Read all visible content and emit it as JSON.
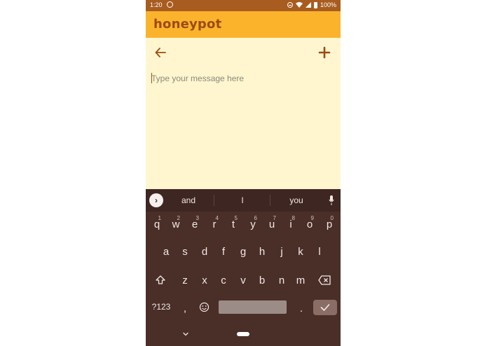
{
  "status_bar": {
    "time": "1:20",
    "battery": "100%"
  },
  "app": {
    "title": "honeypot",
    "brand_color": "#fbb32c",
    "title_color": "#9b4c12"
  },
  "composer": {
    "placeholder": "Type your message here",
    "value": ""
  },
  "keyboard": {
    "suggestions": [
      "and",
      "I",
      "you"
    ],
    "row1": [
      {
        "key": "q",
        "hint": "1"
      },
      {
        "key": "w",
        "hint": "2"
      },
      {
        "key": "e",
        "hint": "3"
      },
      {
        "key": "r",
        "hint": "4"
      },
      {
        "key": "t",
        "hint": "5"
      },
      {
        "key": "y",
        "hint": "6"
      },
      {
        "key": "u",
        "hint": "7"
      },
      {
        "key": "i",
        "hint": "8"
      },
      {
        "key": "o",
        "hint": "9"
      },
      {
        "key": "p",
        "hint": "0"
      }
    ],
    "row2": [
      "a",
      "s",
      "d",
      "f",
      "g",
      "h",
      "j",
      "k",
      "l"
    ],
    "row3": [
      "z",
      "x",
      "c",
      "v",
      "b",
      "n",
      "m"
    ],
    "symbols_key": "?123",
    "comma_key": ",",
    "period_key": "."
  },
  "icons": {
    "back": "arrow-left-icon",
    "add": "plus-icon",
    "expand": "chevron-right-icon",
    "mic": "microphone-icon",
    "shift": "shift-icon",
    "backspace": "backspace-icon",
    "emoji": "emoji-icon",
    "enter": "check-icon"
  }
}
